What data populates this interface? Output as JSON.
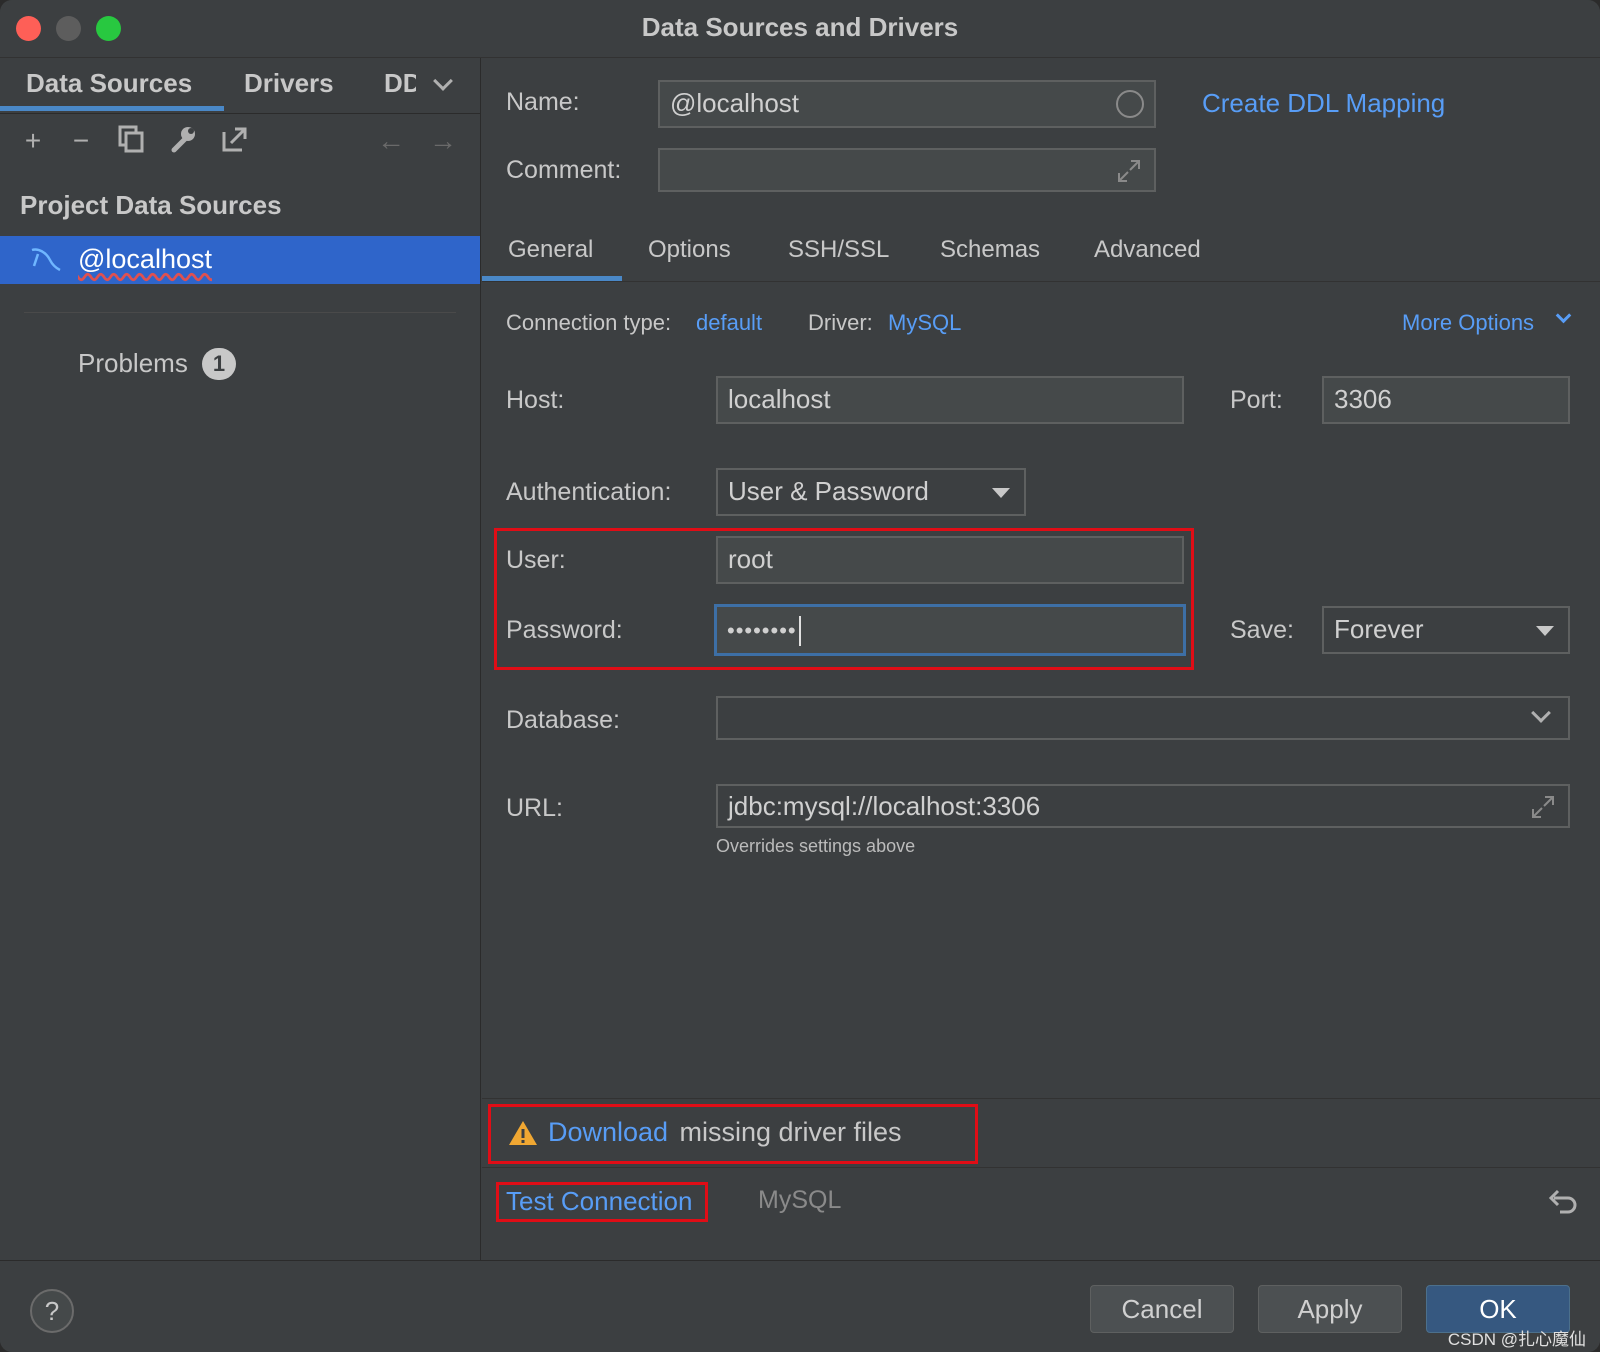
{
  "window": {
    "title": "Data Sources and Drivers"
  },
  "sidebar": {
    "tabs": [
      "Data Sources",
      "Drivers",
      "DD"
    ],
    "section_title": "Project Data Sources",
    "selected_item": "@localhost",
    "problems_label": "Problems",
    "problems_count": "1"
  },
  "main": {
    "name_label": "Name:",
    "name_value": "@localhost",
    "create_ddl_link": "Create DDL Mapping",
    "comment_label": "Comment:",
    "comment_value": "",
    "tabs": [
      "General",
      "Options",
      "SSH/SSL",
      "Schemas",
      "Advanced"
    ],
    "connection_type_label": "Connection type:",
    "connection_type_value": "default",
    "driver_label": "Driver:",
    "driver_value": "MySQL",
    "more_options": "More Options",
    "host_label": "Host:",
    "host_value": "localhost",
    "port_label": "Port:",
    "port_value": "3306",
    "auth_label": "Authentication:",
    "auth_value": "User & Password",
    "user_label": "User:",
    "user_value": "root",
    "password_label": "Password:",
    "password_value": "••••••••",
    "save_label": "Save:",
    "save_value": "Forever",
    "database_label": "Database:",
    "database_value": "",
    "url_label": "URL:",
    "url_value": "jdbc:mysql://localhost:3306",
    "url_hint": "Overrides settings above",
    "warning_link": "Download",
    "warning_text": " missing driver files",
    "test_connection": "Test Connection",
    "driver_footer": "MySQL"
  },
  "footer": {
    "help": "?",
    "cancel": "Cancel",
    "apply": "Apply",
    "ok": "OK",
    "watermark": "CSDN @扎心魔仙"
  },
  "colors": {
    "accent": "#589df6",
    "selection": "#2f65ca",
    "highlight_box": "#e00d16"
  }
}
